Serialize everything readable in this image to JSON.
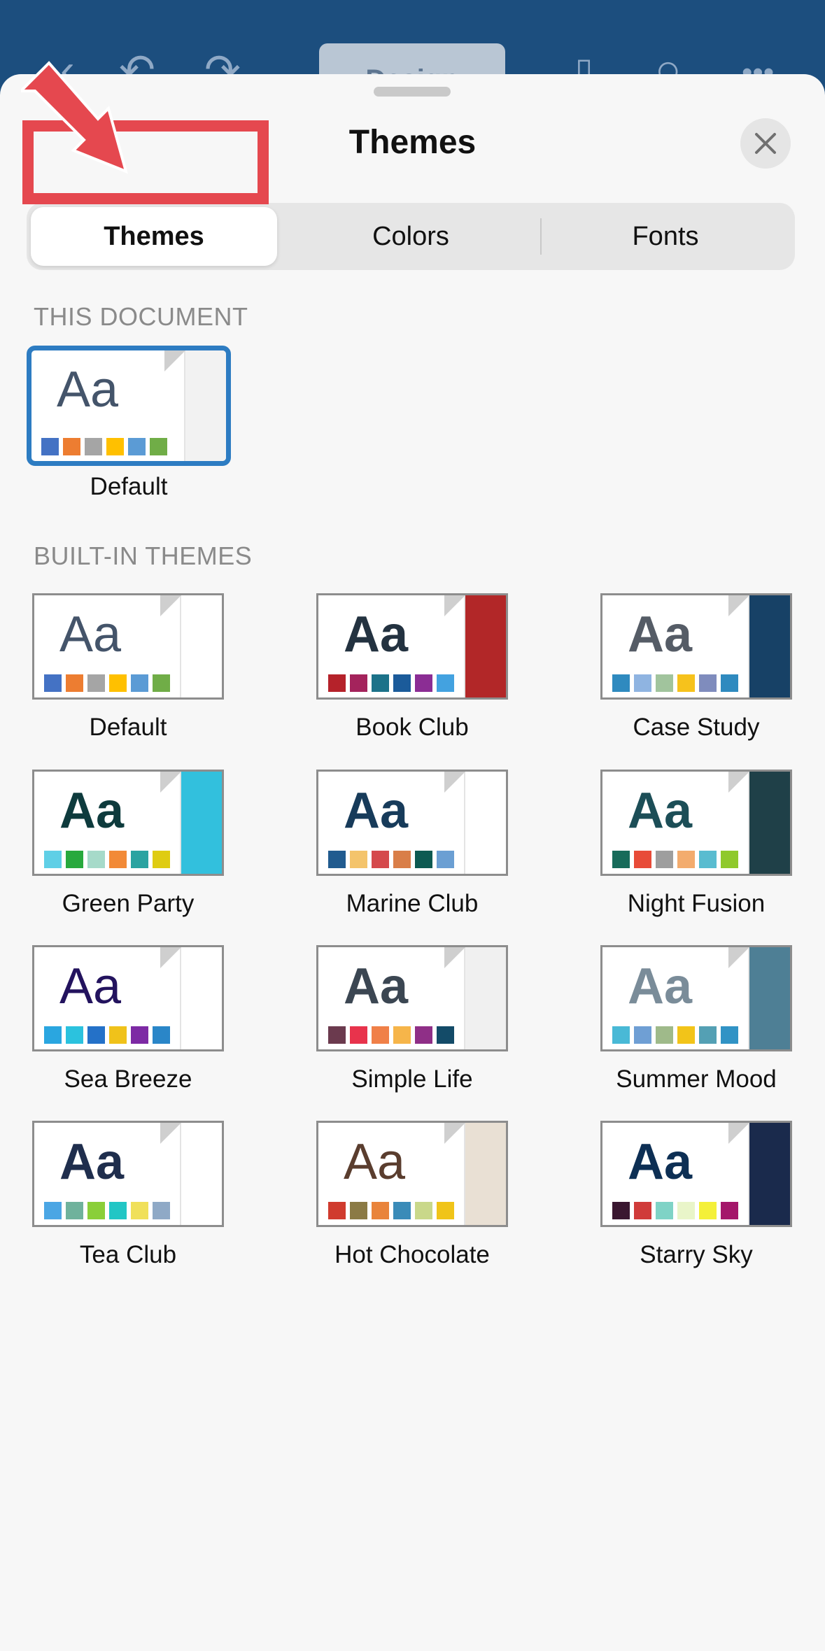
{
  "appbar": {
    "design_label": "Design"
  },
  "sheet": {
    "title": "Themes"
  },
  "tabs": [
    {
      "label": "Themes",
      "active": true
    },
    {
      "label": "Colors",
      "active": false
    },
    {
      "label": "Fonts",
      "active": false
    }
  ],
  "sections": {
    "this_document": "THIS DOCUMENT",
    "built_in": "BUILT-IN THEMES"
  },
  "current_theme": {
    "name": "Default",
    "aa": "Aa",
    "aa_color": "#44546a",
    "bold": false,
    "swatches": [
      "#4472c4",
      "#ed7d31",
      "#a5a5a5",
      "#ffc000",
      "#5b9bd5",
      "#70ad47"
    ],
    "side_color": "#f2f2f2"
  },
  "themes": [
    {
      "name": "Default",
      "aa": "Aa",
      "aa_color": "#44546a",
      "bold": false,
      "swatches": [
        "#4472c4",
        "#ed7d31",
        "#a5a5a5",
        "#ffc000",
        "#5b9bd5",
        "#70ad47"
      ],
      "side_color": "#ffffff"
    },
    {
      "name": "Book Club",
      "aa": "Aa",
      "aa_color": "#233240",
      "bold": true,
      "swatches": [
        "#b5222a",
        "#a4235c",
        "#1c7289",
        "#1b5b9a",
        "#8b2d94",
        "#43a2e0"
      ],
      "side_color": "#b22728"
    },
    {
      "name": "Case Study",
      "aa": "Aa",
      "aa_color": "#555c66",
      "bold": true,
      "swatches": [
        "#2f8abf",
        "#8fb4e1",
        "#a1c49d",
        "#f6c21c",
        "#7f8cbd",
        "#2f8abf"
      ],
      "side_color": "#174166"
    },
    {
      "name": "Green Party",
      "aa": "Aa",
      "aa_color": "#0e3b3d",
      "bold": true,
      "swatches": [
        "#5fcfe6",
        "#28a93d",
        "#a6dac9",
        "#f28a37",
        "#2aa3a1",
        "#dfcc12"
      ],
      "side_color": "#32c0dd"
    },
    {
      "name": "Marine Club",
      "aa": "Aa",
      "aa_color": "#173b5a",
      "bold": true,
      "swatches": [
        "#215b8f",
        "#f4c46b",
        "#d5494c",
        "#d97e48",
        "#0d5a52",
        "#6b9fd3"
      ],
      "side_color": "#ffffff"
    },
    {
      "name": "Night Fusion",
      "aa": "Aa",
      "aa_color": "#1c4e57",
      "bold": true,
      "swatches": [
        "#176b5a",
        "#e84b38",
        "#9e9e9e",
        "#f3ac6e",
        "#59bcd0",
        "#8fc92c"
      ],
      "side_color": "#1f4048"
    },
    {
      "name": "Sea Breeze",
      "aa": "Aa",
      "aa_color": "#23135e",
      "bold": false,
      "swatches": [
        "#2aa6e0",
        "#2bc2de",
        "#2471c8",
        "#f0c21a",
        "#7d2aa4",
        "#2a86c8"
      ],
      "side_color": "#ffffff"
    },
    {
      "name": "Simple Life",
      "aa": "Aa",
      "aa_color": "#3b4652",
      "bold": true,
      "swatches": [
        "#6b3a4e",
        "#e8334c",
        "#f08048",
        "#f6b54a",
        "#8f2f87",
        "#134b68"
      ],
      "side_color": "#f0f0f0"
    },
    {
      "name": "Summer Mood",
      "aa": "Aa",
      "aa_color": "#7a8c99",
      "bold": true,
      "swatches": [
        "#49b9d6",
        "#6f9fd4",
        "#9fba8a",
        "#f2c419",
        "#54a0b4",
        "#3193c5"
      ],
      "side_color": "#4e7f95"
    },
    {
      "name": "Tea Club",
      "aa": "Aa",
      "aa_color": "#1f2e4d",
      "bold": true,
      "swatches": [
        "#4ba6e4",
        "#6fb29c",
        "#8acf39",
        "#22c6c5",
        "#f0e05a",
        "#8fa9c6"
      ],
      "side_color": "#ffffff"
    },
    {
      "name": "Hot Chocolate",
      "aa": "Aa",
      "aa_color": "#5a3d2e",
      "bold": false,
      "swatches": [
        "#d03b2e",
        "#8b7a45",
        "#e9843b",
        "#3a8bb8",
        "#c9d88a",
        "#f0c419"
      ],
      "side_color": "#e9e0d4"
    },
    {
      "name": "Starry Sky",
      "aa": "Aa",
      "aa_color": "#0d2f54",
      "bold": true,
      "swatches": [
        "#3a1730",
        "#d03b3a",
        "#7fd3c6",
        "#e9f5c9",
        "#f4f039",
        "#a4166a"
      ],
      "side_color": "#1a2a4c"
    }
  ]
}
